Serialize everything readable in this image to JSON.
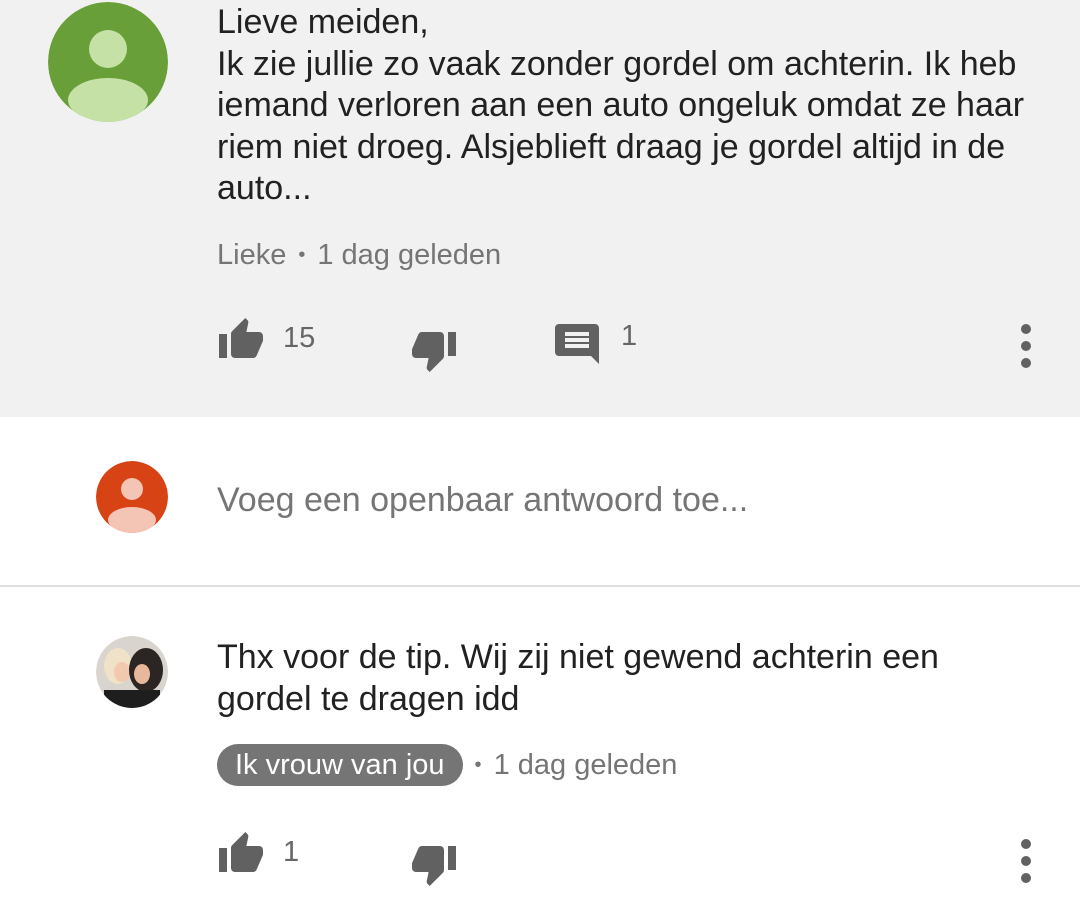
{
  "comments": [
    {
      "text": "Lieve meiden,\nIk zie jullie zo vaak zonder gordel om achterin. Ik heb iemand verloren aan een auto ongeluk omdat ze haar riem niet droeg. Alsjeblieft draag je gordel altijd in de auto...",
      "author": "Lieke",
      "separator": "•",
      "time": "1 dag geleden",
      "likes": "15",
      "replies": "1",
      "avatar_color": "#689f38"
    },
    {
      "text": "Thx voor de tip. Wij zij niet gewend achterin een gordel te dragen idd",
      "author": "Ik vrouw van jou",
      "separator": "•",
      "time": "1 dag geleden",
      "likes": "1"
    }
  ],
  "reply_box": {
    "placeholder": "Voeg een openbaar antwoord toe...",
    "avatar_color": "#d84315"
  },
  "icons": {
    "like": "thumb-up-icon",
    "dislike": "thumb-down-icon",
    "reply": "comment-icon",
    "more": "more-vert-icon"
  }
}
